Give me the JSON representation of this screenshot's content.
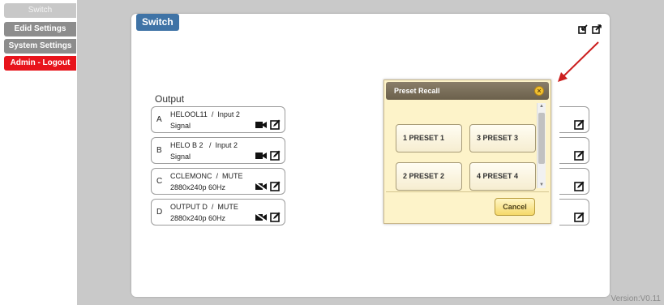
{
  "nav": {
    "switch": "Switch",
    "edid": "Edid Settings",
    "system": "System Settings",
    "admin": "Admin - Logout"
  },
  "panel": {
    "tab": "Switch",
    "output_label": "Output"
  },
  "outputs": [
    {
      "letter": "A",
      "line1": "HELOOL11  /  Input 2",
      "line2": "Signal",
      "video_icon": "video-camera-icon"
    },
    {
      "letter": "B",
      "line1": "HELO B 2   /  Input 2",
      "line2": "Signal",
      "video_icon": "video-camera-icon"
    },
    {
      "letter": "C",
      "line1": "CCLEMONC  /  MUTE",
      "line2": "2880x240p 60Hz",
      "video_icon": "video-muted-icon"
    },
    {
      "letter": "D",
      "line1": "OUTPUT D  /  MUTE",
      "line2": "2880x240p 60Hz",
      "video_icon": "video-muted-icon"
    }
  ],
  "dialog": {
    "title": "Preset Recall",
    "presets": [
      "1  PRESET 1",
      "3  PRESET 3",
      "2  PRESET 2",
      "4  PRESET 4"
    ],
    "cancel": "Cancel"
  },
  "version": "Version:V0.11",
  "colors": {
    "tab_blue": "#3f73a6",
    "admin_red": "#e8141c",
    "arrow_red": "#cc1f1f",
    "dialog_bg": "#fdf3c9"
  }
}
